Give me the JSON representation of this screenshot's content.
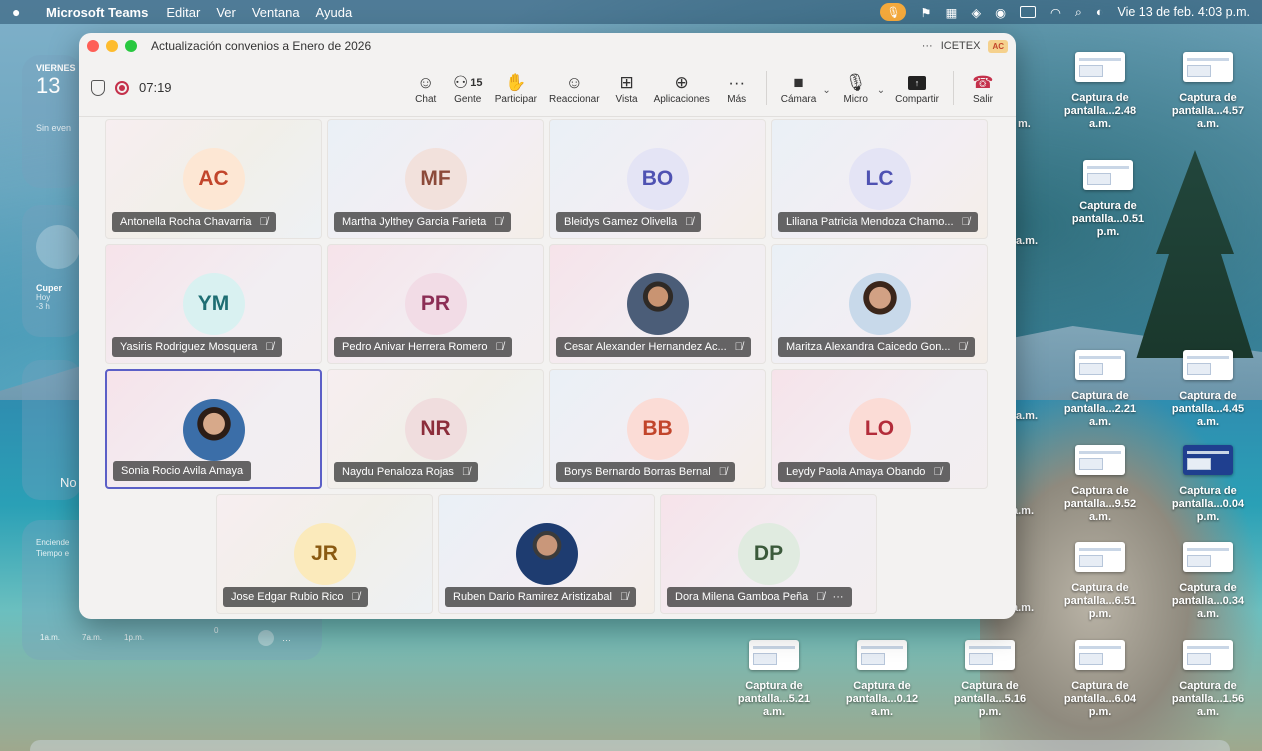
{
  "menubar": {
    "app": "Microsoft Teams",
    "items": [
      "Editar",
      "Ver",
      "Ventana",
      "Ayuda"
    ],
    "datetime": "Vie 13 de feb. 4:03 p.m."
  },
  "widgets": {
    "calendar_day": "VIERNES",
    "calendar_num": "13",
    "calendar_events": "Sin even",
    "clock_city": "Cuper",
    "clock_sub1": "Hoy",
    "clock_sub2": "-3 h",
    "blank_label": "No",
    "weather_text1": "Enciende",
    "weather_text2": "Tiempo e",
    "weather_times": [
      "1a.m.",
      "7a.m.",
      "1p.m."
    ],
    "weather_zero": "0",
    "weather_more": "···"
  },
  "desktop": {
    "icons": [
      {
        "line1": "Captura de",
        "line2": "pantalla...2.48 a.m.",
        "dark": false
      },
      {
        "line1": "Captura de",
        "line2": "pantalla...4.57 a.m.",
        "dark": false
      },
      {
        "line1": "Captura de",
        "line2": "pantalla...0.51 p.m.",
        "dark": false
      },
      {
        "line1": "Captura de",
        "line2": "pantalla...2.21 a.m.",
        "dark": false
      },
      {
        "line1": "Captura de",
        "line2": "pantalla...4.45 a.m.",
        "dark": false
      },
      {
        "line1": "Captura de",
        "line2": "pantalla...9.52 a.m.",
        "dark": false
      },
      {
        "line1": "Captura de",
        "line2": "pantalla...0.04 p.m.",
        "dark": true
      },
      {
        "line1": "Captura de",
        "line2": "pantalla...6.51 p.m.",
        "dark": false
      },
      {
        "line1": "Captura de",
        "line2": "pantalla...0.34 a.m.",
        "dark": false
      },
      {
        "line1": "Captura de",
        "line2": "pantalla...5.21 a.m.",
        "dark": false
      },
      {
        "line1": "Captura de",
        "line2": "pantalla...0.12 a.m.",
        "dark": false
      },
      {
        "line1": "Captura de",
        "line2": "pantalla...5.16 p.m.",
        "dark": false
      },
      {
        "line1": "Captura de",
        "line2": "pantalla...6.04 p.m.",
        "dark": false
      },
      {
        "line1": "Captura de",
        "line2": "pantalla...1.56 a.m.",
        "dark": false
      }
    ],
    "partials": [
      "m.",
      "a.m.",
      "a.m.",
      "a.m.",
      "a.m."
    ]
  },
  "meeting": {
    "title": "Actualización convenios a Enero de 2026",
    "more": "···",
    "org": "ICETEX",
    "org_badge": "AC",
    "timer": "07:19",
    "people_count": "15",
    "toolbar": {
      "chat": "Chat",
      "people": "Gente",
      "raise": "Participar",
      "react": "Reaccionar",
      "view": "Vista",
      "apps": "Aplicaciones",
      "more": "Más",
      "camera": "Cámara",
      "mic": "Micro",
      "share": "Compartir",
      "leave": "Salir"
    },
    "participants": [
      {
        "initials": "AC",
        "name": "Antonella Rocha Chavarria",
        "bg": "#fde7d4",
        "fg": "#c2452b",
        "photo": "",
        "muted": true
      },
      {
        "initials": "MF",
        "name": "Martha Jylthey Garcia Farieta",
        "bg": "#f2e1dc",
        "fg": "#8c4a3a",
        "photo": "",
        "muted": true
      },
      {
        "initials": "BO",
        "name": "Bleidys Gamez Olivella",
        "bg": "#e4e4f5",
        "fg": "#4f52b2",
        "photo": "",
        "muted": true
      },
      {
        "initials": "LC",
        "name": "Liliana Patricia Mendoza Chamo...",
        "bg": "#e4e4f5",
        "fg": "#4f52b2",
        "photo": "",
        "muted": true
      },
      {
        "initials": "YM",
        "name": "Yasiris Rodriguez Mosquera",
        "bg": "#d9f1f1",
        "fg": "#1e6e73",
        "photo": "",
        "muted": true
      },
      {
        "initials": "PR",
        "name": "Pedro Anivar Herrera Romero",
        "bg": "#f2dce6",
        "fg": "#8c2d55",
        "photo": "",
        "muted": true
      },
      {
        "initials": "",
        "name": "Cesar Alexander Hernandez Ac...",
        "bg": "",
        "fg": "",
        "photo": "m1",
        "muted": true
      },
      {
        "initials": "",
        "name": "Maritza Alexandra Caicedo Gon...",
        "bg": "",
        "fg": "",
        "photo": "f1",
        "muted": true
      },
      {
        "initials": "",
        "name": "Sonia Rocio Avila Amaya",
        "bg": "",
        "fg": "",
        "photo": "f2",
        "muted": false
      },
      {
        "initials": "NR",
        "name": "Naydu Penaloza Rojas",
        "bg": "#f0ddde",
        "fg": "#8c2d3a",
        "photo": "",
        "muted": true
      },
      {
        "initials": "BB",
        "name": "Borys Bernardo Borras Bernal",
        "bg": "#fbdcd6",
        "fg": "#c2452b",
        "photo": "",
        "muted": true
      },
      {
        "initials": "LO",
        "name": "Leydy Paola Amaya Obando",
        "bg": "#fbdcd6",
        "fg": "#b32c3a",
        "photo": "",
        "muted": true
      },
      {
        "initials": "JR",
        "name": "Jose Edgar Rubio Rico",
        "bg": "#fbeabb",
        "fg": "#8a5a12",
        "photo": "",
        "muted": true
      },
      {
        "initials": "",
        "name": "Ruben Dario Ramirez Aristizabal",
        "bg": "",
        "fg": "",
        "photo": "m2",
        "muted": true
      },
      {
        "initials": "DP",
        "name": "Dora Milena Gamboa Peña",
        "bg": "#e0ebe0",
        "fg": "#3b5a3b",
        "photo": "",
        "muted": true,
        "extra": "···"
      }
    ]
  }
}
